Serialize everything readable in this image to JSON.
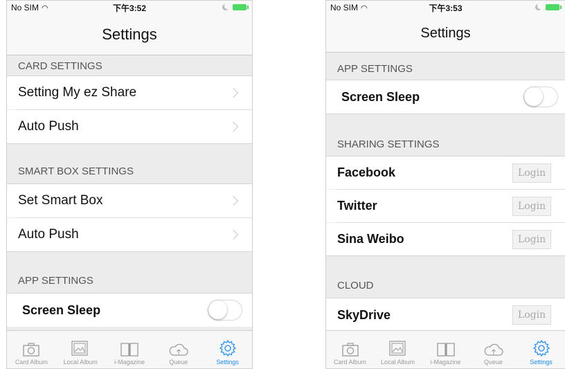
{
  "left": {
    "status": {
      "carrier": "No SIM",
      "time": "下午3:52"
    },
    "title": "Settings",
    "sections": [
      {
        "header": "CARD SETTINGS",
        "items": [
          {
            "label": "Setting My ez Share"
          },
          {
            "label": "Auto Push"
          }
        ]
      },
      {
        "header": "SMART BOX SETTINGS",
        "items": [
          {
            "label": "Set Smart Box"
          },
          {
            "label": "Auto Push"
          }
        ]
      },
      {
        "header": "APP SETTINGS",
        "items": [
          {
            "label": "Screen Sleep",
            "toggle": "off"
          }
        ]
      }
    ]
  },
  "right": {
    "status": {
      "carrier": "No SIM",
      "time": "下午3:53"
    },
    "title": "Settings",
    "sections": [
      {
        "header": "APP SETTINGS",
        "items": [
          {
            "label": "Screen Sleep",
            "toggle": "off"
          }
        ]
      },
      {
        "header": "SHARING SETTINGS",
        "items": [
          {
            "label": "Facebook",
            "button": "Login"
          },
          {
            "label": "Twitter",
            "button": "Login"
          },
          {
            "label": "Sina Weibo",
            "button": "Login"
          }
        ]
      },
      {
        "header": "CLOUD",
        "items": [
          {
            "label": "SkyDrive",
            "button": "Login"
          }
        ]
      }
    ]
  },
  "tabs": [
    {
      "label": "Card Album",
      "icon": "camera-icon"
    },
    {
      "label": "Local Album",
      "icon": "photo-icon"
    },
    {
      "label": "i-Magazine",
      "icon": "book-icon"
    },
    {
      "label": "Queue",
      "icon": "cloud-upload-icon"
    },
    {
      "label": "Settings",
      "icon": "gear-icon",
      "active": true
    }
  ],
  "colors": {
    "accent": "#1a8cff",
    "battery": "#4cd964",
    "background": "#ececec"
  }
}
